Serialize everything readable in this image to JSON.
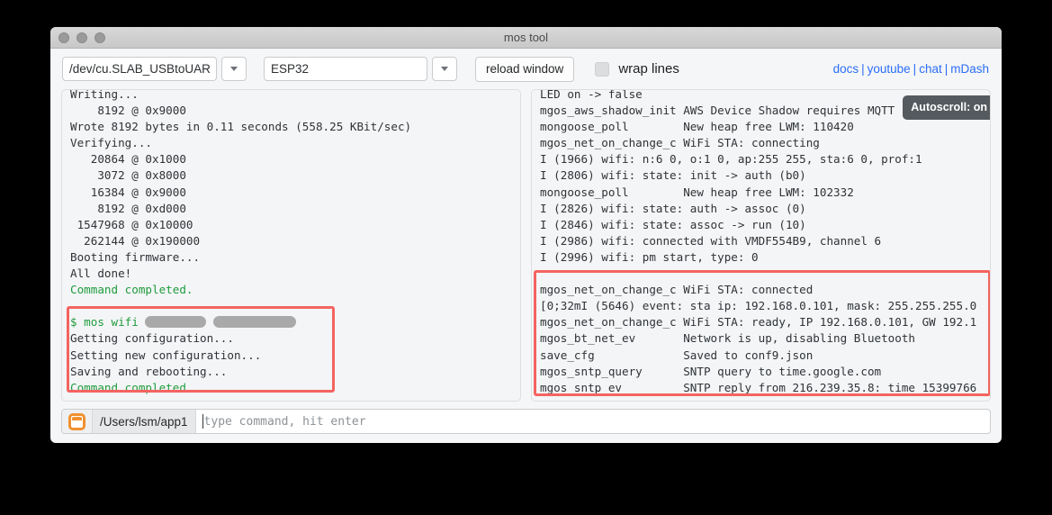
{
  "window": {
    "title": "mos tool",
    "traffic_lights": [
      "close",
      "minimize",
      "zoom"
    ]
  },
  "toolbar": {
    "port_value": "/dev/cu.SLAB_USBtoUAR",
    "arch_value": "ESP32",
    "reload_label": "reload window",
    "wrap_label": "wrap lines",
    "wrap_checked": false,
    "links": [
      {
        "label": "docs"
      },
      {
        "label": "youtube"
      },
      {
        "label": "chat"
      },
      {
        "label": "mDash"
      }
    ],
    "link_separator": "|"
  },
  "left_pane": {
    "lines": [
      {
        "text": "Writing...",
        "class": ""
      },
      {
        "text": "    8192 @ 0x9000",
        "class": ""
      },
      {
        "text": "Wrote 8192 bytes in 0.11 seconds (558.25 KBit/sec)",
        "class": ""
      },
      {
        "text": "Verifying...",
        "class": ""
      },
      {
        "text": "   20864 @ 0x1000",
        "class": ""
      },
      {
        "text": "    3072 @ 0x8000",
        "class": ""
      },
      {
        "text": "   16384 @ 0x9000",
        "class": ""
      },
      {
        "text": "    8192 @ 0xd000",
        "class": ""
      },
      {
        "text": " 1547968 @ 0x10000",
        "class": ""
      },
      {
        "text": "  262144 @ 0x190000",
        "class": ""
      },
      {
        "text": "Booting firmware...",
        "class": ""
      },
      {
        "text": "All done!",
        "class": ""
      },
      {
        "text": "Command completed.",
        "class": "green"
      }
    ],
    "highlight_lines": [
      {
        "prompt": "$ mos wifi ",
        "redacted": [
          68,
          92
        ]
      },
      {
        "text": "Getting configuration...",
        "class": ""
      },
      {
        "text": "Setting new configuration...",
        "class": ""
      },
      {
        "text": "Saving and rebooting...",
        "class": ""
      },
      {
        "text": "Command completed.",
        "class": "green"
      }
    ]
  },
  "right_pane": {
    "lines": [
      {
        "text": "LED on -> false",
        "class": ""
      },
      {
        "text": "mgos_aws_shadow_init AWS Device Shadow requires MQTT",
        "class": ""
      },
      {
        "text": "mongoose_poll        New heap free LWM: 110420",
        "class": ""
      },
      {
        "text": "mgos_net_on_change_c WiFi STA: connecting",
        "class": ""
      },
      {
        "text": "I (1966) wifi: n:6 0, o:1 0, ap:255 255, sta:6 0, prof:1",
        "class": ""
      },
      {
        "text": "I (2806) wifi: state: init -> auth (b0)",
        "class": ""
      },
      {
        "text": "mongoose_poll        New heap free LWM: 102332",
        "class": ""
      },
      {
        "text": "I (2826) wifi: state: auth -> assoc (0)",
        "class": ""
      },
      {
        "text": "I (2846) wifi: state: assoc -> run (10)",
        "class": ""
      },
      {
        "text": "I (2986) wifi: connected with VMDF554B9, channel 6",
        "class": ""
      },
      {
        "text": "I (2996) wifi: pm start, type: 0",
        "class": ""
      }
    ],
    "highlight_lines": [
      {
        "text": "mgos_net_on_change_c WiFi STA: connected",
        "class": ""
      },
      {
        "text": "[0;32mI (5646) event: sta ip: 192.168.0.101, mask: 255.255.255.0",
        "class": ""
      },
      {
        "text": "mgos_net_on_change_c WiFi STA: ready, IP 192.168.0.101, GW 192.1",
        "class": ""
      },
      {
        "text": "mgos_bt_net_ev       Network is up, disabling Bluetooth",
        "class": ""
      },
      {
        "text": "save_cfg             Saved to conf9.json",
        "class": ""
      },
      {
        "text": "mgos_sntp_query      SNTP query to time.google.com",
        "class": ""
      },
      {
        "text": "mgos_sntp_ev         SNTP reply from 216.239.35.8: time 15399766",
        "class": ""
      }
    ],
    "autoscroll_badge": "Autoscroll: on"
  },
  "command_bar": {
    "path": "/Users/lsm/app1",
    "placeholder": "type command, hit enter",
    "value": ""
  },
  "colors": {
    "highlight": "#f4645f",
    "link": "#2b6ef6",
    "success": "#1f9c3d",
    "folder_icon": "#f0912f",
    "badge_bg": "#555a5f"
  }
}
